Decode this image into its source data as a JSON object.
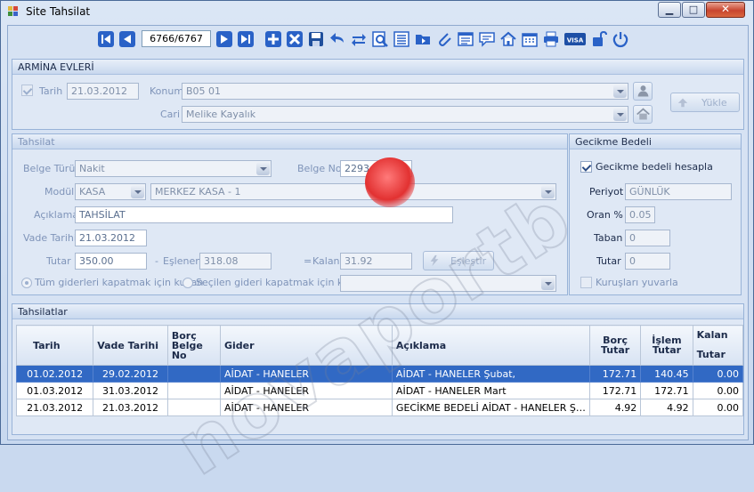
{
  "window": {
    "title": "Site Tahsilat",
    "controls": {
      "minimize": "▁",
      "maximize": "□",
      "close": "✕"
    }
  },
  "toolbar": {
    "record_position": "6766/6767",
    "icons": [
      "first-record-icon",
      "previous-record-icon",
      "next-record-icon",
      "last-record-icon",
      "add-icon",
      "delete-icon",
      "save-icon",
      "undo-icon",
      "refresh-icon",
      "preview-icon",
      "list-icon",
      "folder-icon",
      "attachment-icon",
      "report-icon",
      "message-icon",
      "home-icon",
      "calendar-icon",
      "print-icon",
      "visa-icon",
      "unlock-icon",
      "power-icon"
    ],
    "visa_label": "VISA"
  },
  "arming": {
    "header": "ARMİNA EVLERİ",
    "tarih_label": "Tarih",
    "tarih_value": "21.03.2012",
    "tarih_checked": true,
    "konum_label": "Konum",
    "konum_value": "B05 01",
    "cari_label": "Cari",
    "cari_value": "Melike Kayalık",
    "yukle_label": "Yükle"
  },
  "tahsilat": {
    "header": "Tahsilat",
    "belge_turu_label": "Belge Türü",
    "belge_turu_value": "Nakit",
    "belge_no_label": "Belge No",
    "belge_no_value": "2293",
    "modul_label": "Modül",
    "modul_value": "KASA",
    "modul_detail_value": "MERKEZ KASA - 1",
    "aciklama_label": "Açıklama",
    "aciklama_value": "TAHSİLAT",
    "vade_tarihi_label": "Vade Tarihi",
    "vade_tarihi_value": "21.03.2012",
    "tutar_label": "Tutar",
    "tutar_value": "350.00",
    "eslenen_label": "Eşlenen",
    "eslenen_value": "318.08",
    "kalan_label": "Kalan",
    "kalan_value": "31.92",
    "eslestir_label": "Eşleştir",
    "minus_sign": "-",
    "equals_sign": "=",
    "radio_all_label": "Tüm giderleri kapatmak için kullan",
    "radio_selected_label": "Seçilen gideri kapatmak için kullan",
    "selected_gider_value": ""
  },
  "gecikme": {
    "header": "Gecikme Bedeli",
    "hesapla_label": "Gecikme bedeli hesapla",
    "hesapla_checked": true,
    "periyot_label": "Periyot",
    "periyot_value": "GÜNLÜK",
    "oran_label": "Oran %",
    "oran_value": "0.05",
    "taban_label": "Taban",
    "taban_value": "0",
    "tutar_label": "Tutar",
    "tutar_value": "0",
    "kurus_label": "Kuruşları yuvarla",
    "kurus_checked": false
  },
  "tahsilatlar": {
    "header": "Tahsilatlar",
    "columns": [
      "Tarih",
      "Vade Tarihi",
      "Borç Belge No",
      "Gider",
      "Açıklama",
      "Borç Tutar",
      "İşlem Tutar",
      "Kalan Tutar"
    ],
    "rows": [
      {
        "tarih": "01.02.2012",
        "vade": "29.02.2012",
        "belge": "",
        "gider": "AİDAT - HANELER",
        "aciklama": "AİDAT - HANELER Şubat,",
        "borc": "172.71",
        "islem": "140.45",
        "kalan": "0.00",
        "selected": true
      },
      {
        "tarih": "01.03.2012",
        "vade": "31.03.2012",
        "belge": "",
        "gider": "AİDAT - HANELER",
        "aciklama": "AİDAT - HANELER Mart",
        "borc": "172.71",
        "islem": "172.71",
        "kalan": "0.00",
        "selected": false
      },
      {
        "tarih": "21.03.2012",
        "vade": "21.03.2012",
        "belge": "",
        "gider": "AİDAT - HANELER",
        "aciklama": "GECİKME BEDELİ  AİDAT - HANELER Ş…",
        "borc": "4.92",
        "islem": "4.92",
        "kalan": "0.00",
        "selected": false
      }
    ]
  },
  "watermark": "novaportb"
}
